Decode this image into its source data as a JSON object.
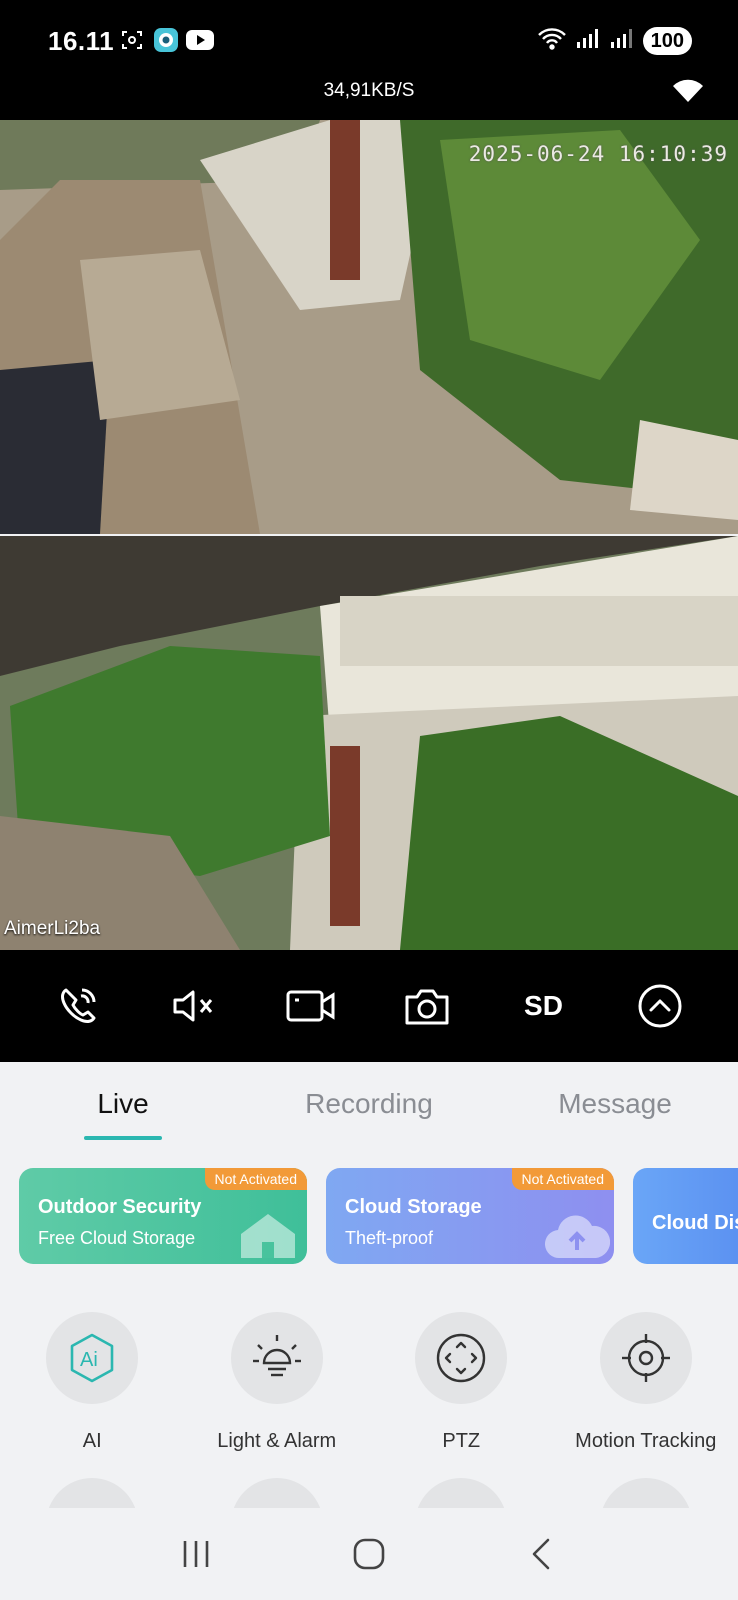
{
  "status_bar": {
    "time": "16.11",
    "battery": "100",
    "network_speed": "34,91KB/S"
  },
  "feeds": {
    "top": {
      "timestamp": "2025-06-24 16:10:39"
    },
    "bottom": {
      "camera_name": "AimerLi2ba"
    }
  },
  "controls": {
    "sd_label": "SD"
  },
  "tabs": [
    {
      "label": "Live",
      "active": true
    },
    {
      "label": "Recording",
      "active": false
    },
    {
      "label": "Message",
      "active": false
    }
  ],
  "cards": [
    {
      "title": "Outdoor Security",
      "subtitle": "Free Cloud Storage",
      "badge": "Not Activated"
    },
    {
      "title": "Cloud Storage",
      "subtitle": "Theft-proof",
      "badge": "Not Activated"
    },
    {
      "title": "Cloud Dis"
    }
  ],
  "features": [
    {
      "label": "AI",
      "icon": "ai-icon"
    },
    {
      "label": "Light & Alarm",
      "icon": "bulb-icon"
    },
    {
      "label": "PTZ",
      "icon": "ptz-icon"
    },
    {
      "label": "Motion Tracking",
      "icon": "crosshair-icon"
    }
  ],
  "colors": {
    "accent": "#2bb7b0",
    "badge": "#f29a38",
    "card_green": "#4fc6a0",
    "card_blue": "#8a9cf1"
  }
}
